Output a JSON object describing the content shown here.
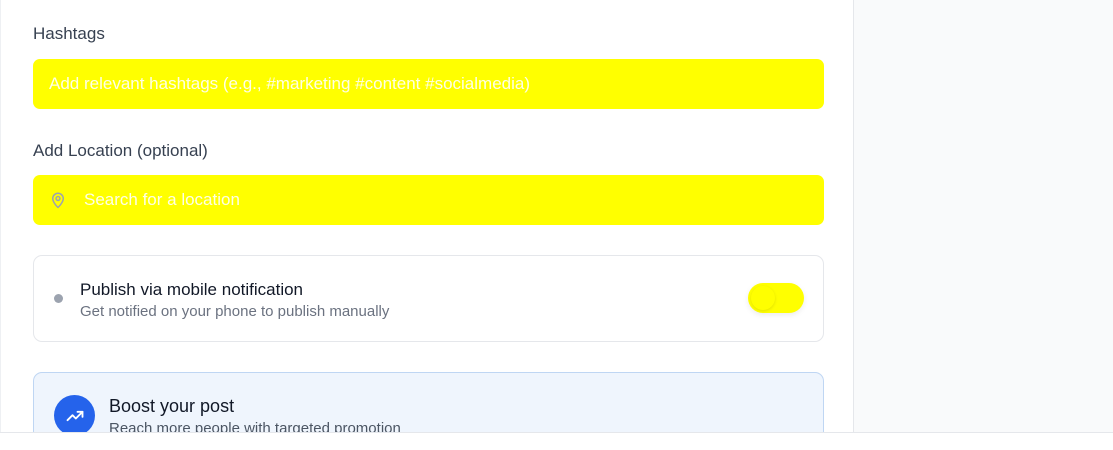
{
  "hashtags": {
    "label": "Hashtags",
    "placeholder": "Add relevant hashtags (e.g., #marketing #content #socialmedia)",
    "value": ""
  },
  "location": {
    "label": "Add Location (optional)",
    "placeholder": "Search for a location",
    "value": "",
    "icon": "map-pin-icon"
  },
  "mobile_notification": {
    "title": "Publish via mobile notification",
    "subtitle": "Get notified on your phone to publish manually",
    "enabled": false,
    "status_color": "#9ca3af",
    "toggle_color": "#ffff00"
  },
  "boost": {
    "title": "Boost your post",
    "subtitle": "Reach more people with targeted promotion",
    "icon": "trending-up-icon",
    "accent_color": "#2563eb"
  },
  "colors": {
    "input_highlight": "#ffff00",
    "boost_background": "#eff5fd"
  }
}
